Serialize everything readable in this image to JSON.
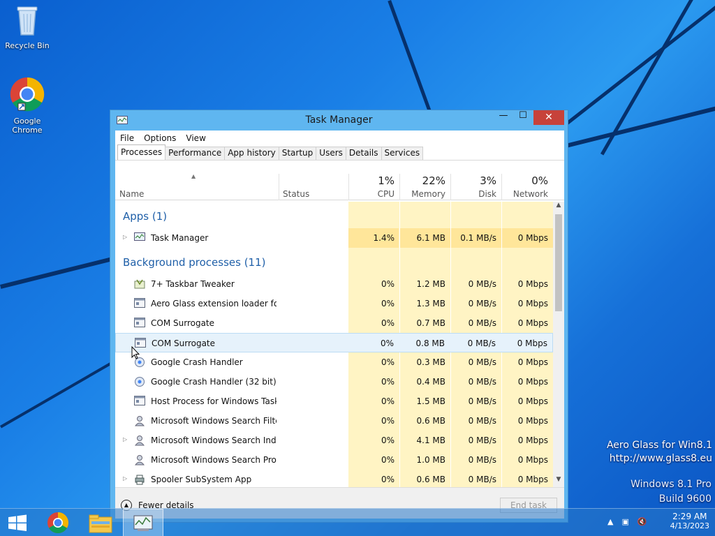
{
  "desktop": {
    "icons": [
      {
        "label": "Recycle Bin",
        "icon": "recycle-bin-icon"
      },
      {
        "label": "Google Chrome",
        "icon": "chrome-icon"
      }
    ],
    "watermark": {
      "line1": "Aero Glass for Win8.1",
      "line2": "http://www.glass8.eu",
      "line3": "Windows 8.1 Pro",
      "line4": "Build 9600"
    }
  },
  "window": {
    "title": "Task Manager",
    "controls": {
      "minimize": "—",
      "maximize": "☐",
      "close": "✕"
    }
  },
  "menu": [
    "File",
    "Options",
    "View"
  ],
  "tabs": [
    "Processes",
    "Performance",
    "App history",
    "Startup",
    "Users",
    "Details",
    "Services"
  ],
  "active_tab": "Processes",
  "columns": {
    "name": "Name",
    "status": "Status",
    "cpu": {
      "pct": "1%",
      "label": "CPU"
    },
    "memory": {
      "pct": "22%",
      "label": "Memory"
    },
    "disk": {
      "pct": "3%",
      "label": "Disk"
    },
    "network": {
      "pct": "0%",
      "label": "Network"
    }
  },
  "groups": {
    "apps": "Apps (1)",
    "background": "Background processes (11)"
  },
  "apps": [
    {
      "name": "Task Manager",
      "cpu": "1.4%",
      "memory": "6.1 MB",
      "disk": "0.1 MB/s",
      "network": "0 Mbps",
      "expandable": true
    }
  ],
  "background": [
    {
      "name": "7+ Taskbar Tweaker",
      "cpu": "0%",
      "memory": "1.2 MB",
      "disk": "0 MB/s",
      "network": "0 Mbps"
    },
    {
      "name": "Aero Glass extension loader for ...",
      "cpu": "0%",
      "memory": "1.3 MB",
      "disk": "0 MB/s",
      "network": "0 Mbps"
    },
    {
      "name": "COM Surrogate",
      "cpu": "0%",
      "memory": "0.7 MB",
      "disk": "0 MB/s",
      "network": "0 Mbps"
    },
    {
      "name": "COM Surrogate",
      "cpu": "0%",
      "memory": "0.8 MB",
      "disk": "0 MB/s",
      "network": "0 Mbps"
    },
    {
      "name": "Google Crash Handler",
      "cpu": "0%",
      "memory": "0.3 MB",
      "disk": "0 MB/s",
      "network": "0 Mbps"
    },
    {
      "name": "Google Crash Handler (32 bit)",
      "cpu": "0%",
      "memory": "0.4 MB",
      "disk": "0 MB/s",
      "network": "0 Mbps"
    },
    {
      "name": "Host Process for Windows Tasks",
      "cpu": "0%",
      "memory": "1.5 MB",
      "disk": "0 MB/s",
      "network": "0 Mbps"
    },
    {
      "name": "Microsoft Windows Search Filte...",
      "cpu": "0%",
      "memory": "0.6 MB",
      "disk": "0 MB/s",
      "network": "0 Mbps"
    },
    {
      "name": "Microsoft Windows Search Inde...",
      "cpu": "0%",
      "memory": "4.1 MB",
      "disk": "0 MB/s",
      "network": "0 Mbps"
    },
    {
      "name": "Microsoft Windows Search Prot...",
      "cpu": "0%",
      "memory": "1.0 MB",
      "disk": "0 MB/s",
      "network": "0 Mbps"
    },
    {
      "name": "Spooler SubSystem App",
      "cpu": "0%",
      "memory": "0.6 MB",
      "disk": "0 MB/s",
      "network": "0 Mbps"
    }
  ],
  "footer": {
    "fewer_details": "Fewer details",
    "end_task": "End task"
  },
  "taskbar": {
    "time": "2:29 AM",
    "date": "4/13/2023",
    "pinned": [
      "start-button",
      "chrome-icon",
      "file-explorer-icon",
      "task-manager-icon"
    ]
  }
}
